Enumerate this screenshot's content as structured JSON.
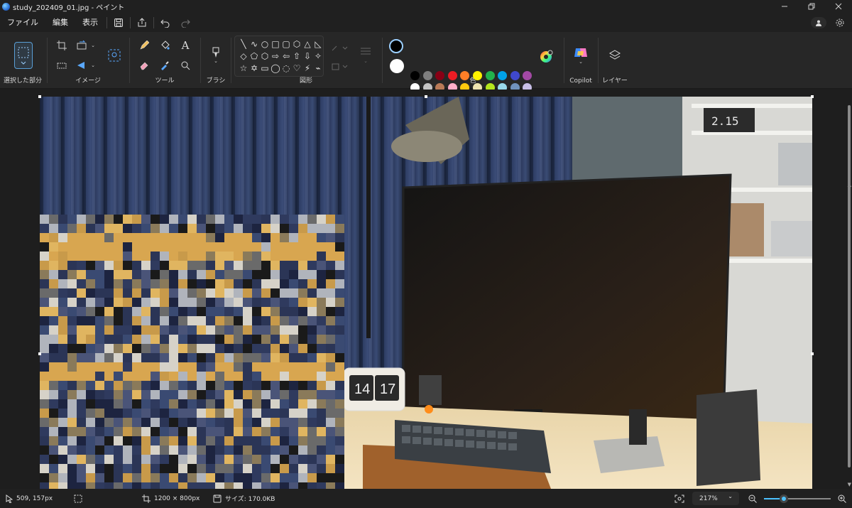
{
  "window": {
    "title": "study_202409_01.jpg - ペイント",
    "controls": [
      "minimize",
      "restore",
      "close"
    ]
  },
  "menubar": {
    "items": [
      "ファイル",
      "編集",
      "表示"
    ],
    "quick_actions": [
      "save-icon",
      "share-icon",
      "undo-icon",
      "redo-icon"
    ],
    "right_icons": [
      "account-icon",
      "gear-icon"
    ]
  },
  "ribbon": {
    "groups": {
      "selection": "選択した部分",
      "image": "イメージ",
      "tools": "ツール",
      "brushes": "ブラシ",
      "shapes": "図形",
      "colors": "色",
      "copilot": "Copilot",
      "layers": "レイヤー"
    },
    "shape_glyphs": [
      "╲",
      "∿",
      "○",
      "□",
      "▢",
      "⬡",
      "△",
      "◺",
      "◇",
      "⬠",
      "⬡",
      "⇨",
      "⇦",
      "⇧",
      "⇩",
      "✧",
      "☆",
      "✡",
      "▭",
      "◯",
      "◌",
      "♡",
      "⚡",
      "⌁"
    ],
    "current_colors": {
      "primary": "#000000",
      "secondary": "#ffffff"
    },
    "palette_row1": [
      "#000000",
      "#7f7f7f",
      "#880015",
      "#ed1c24",
      "#ff7f27",
      "#fff200",
      "#22b14c",
      "#00a2e8",
      "#3f48cc",
      "#a349a4"
    ],
    "palette_row2": [
      "#ffffff",
      "#c3c3c3",
      "#b97a57",
      "#ffaec9",
      "#ffc90e",
      "#efe4b0",
      "#b5e61d",
      "#99d9ea",
      "#7092be",
      "#c8bfe7"
    ],
    "palette_row3_count": 10
  },
  "canvas": {
    "photo": {
      "clock_hour": "14",
      "clock_minute": "17",
      "shelf_clock": "2.15"
    }
  },
  "statusbar": {
    "cursor_pos": "509, 157px",
    "image_size": "1200 × 800px",
    "file_size": "サイズ: 170.0KB",
    "zoom": "217%",
    "zoom_slider_fraction": 0.3
  }
}
